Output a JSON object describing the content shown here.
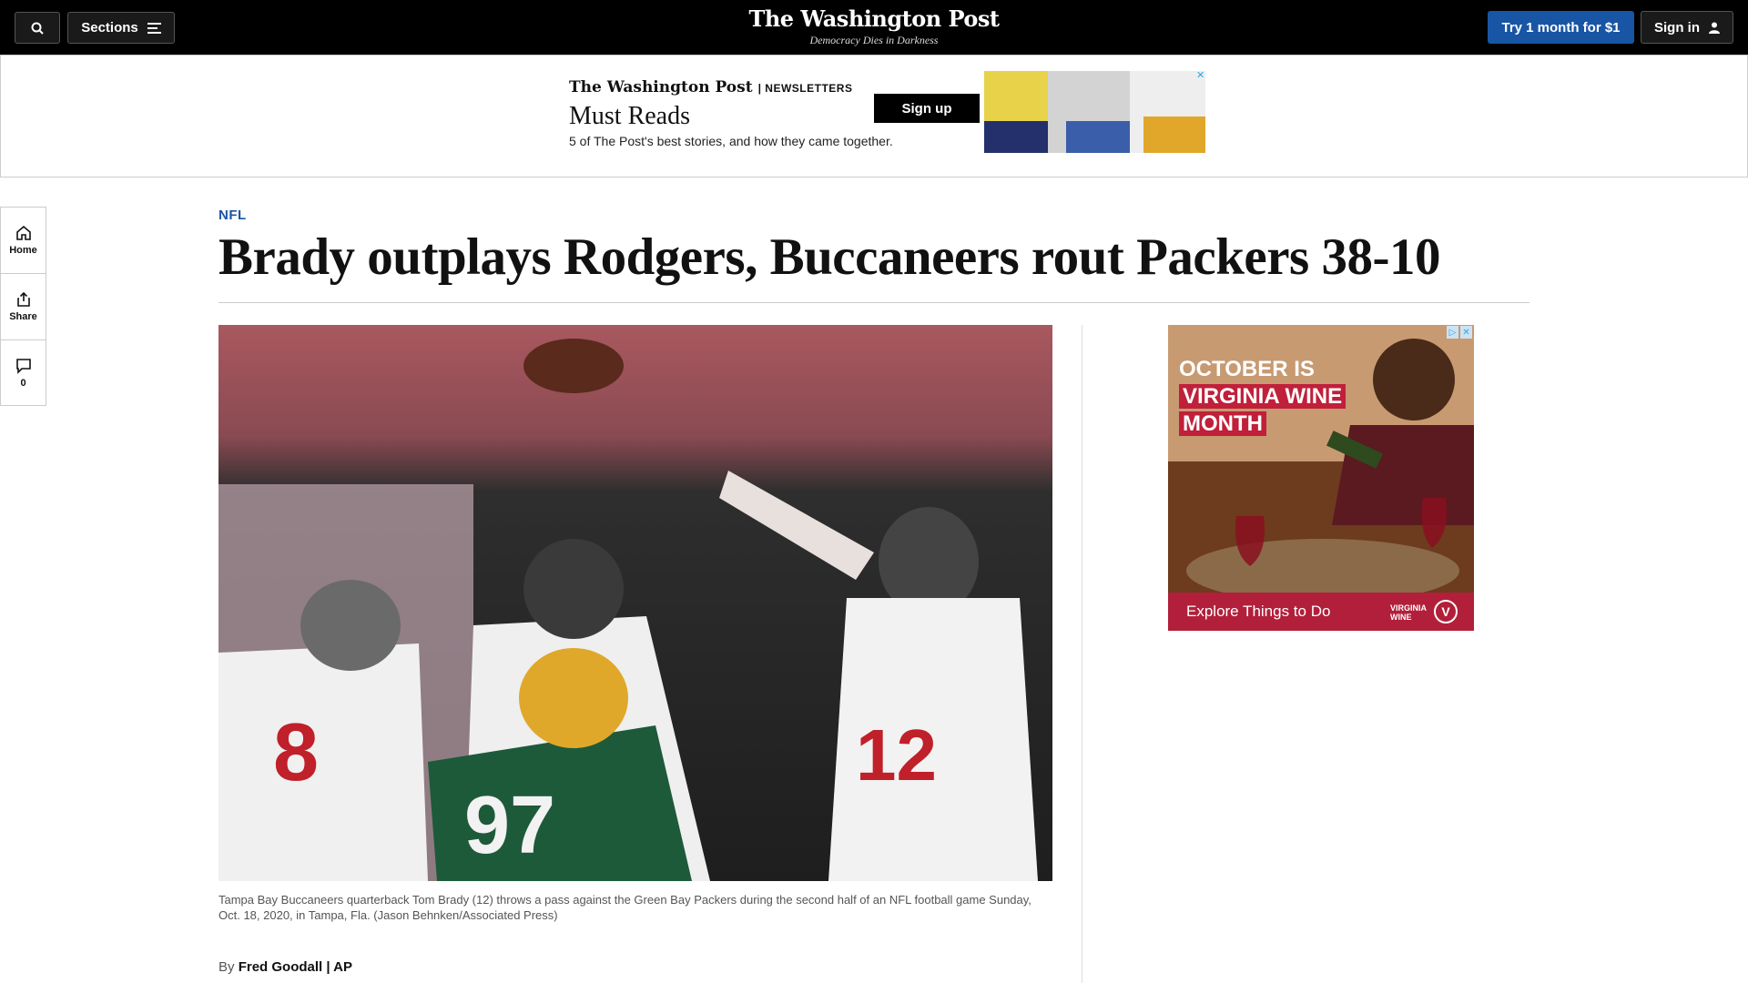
{
  "header": {
    "sections_label": "Sections",
    "brand_name": "The Washington Post",
    "brand_tagline": "Democracy Dies in Darkness",
    "subscribe_label": "Try 1 month for $1",
    "signin_label": "Sign in"
  },
  "newsletter_ad": {
    "brand": "The Washington Post",
    "section": "NEWSLETTERS",
    "title": "Must Reads",
    "description": "5 of The Post's best stories, and how they came together.",
    "cta": "Sign up",
    "close": "✕"
  },
  "rail": {
    "home_label": "Home",
    "share_label": "Share",
    "comments_count": "0"
  },
  "article": {
    "kicker": "NFL",
    "headline": "Brady outplays Rodgers, Buccaneers rout Packers 38-10",
    "caption": "Tampa Bay Buccaneers quarterback Tom Brady (12) throws a pass against the Green Bay Packers during the second half of an NFL football game Sunday, Oct. 18, 2020, in Tampa, Fla. (Jason Behnken/Associated Press)",
    "byline_prefix": "By",
    "byline_author": "Fred Goodall | AP"
  },
  "side_ad": {
    "line1": "OCTOBER IS",
    "line2": "VIRGINIA WINE",
    "line3": "MONTH",
    "cta": "Explore Things to Do",
    "badge_letter": "V",
    "badge_text_1": "VIRGINIA",
    "badge_text_2": "WINE",
    "adchoices": "▷",
    "close": "✕"
  },
  "colors": {
    "accent": "#1955a5",
    "topbar": "#000000",
    "ad_red": "#b21f3a"
  }
}
